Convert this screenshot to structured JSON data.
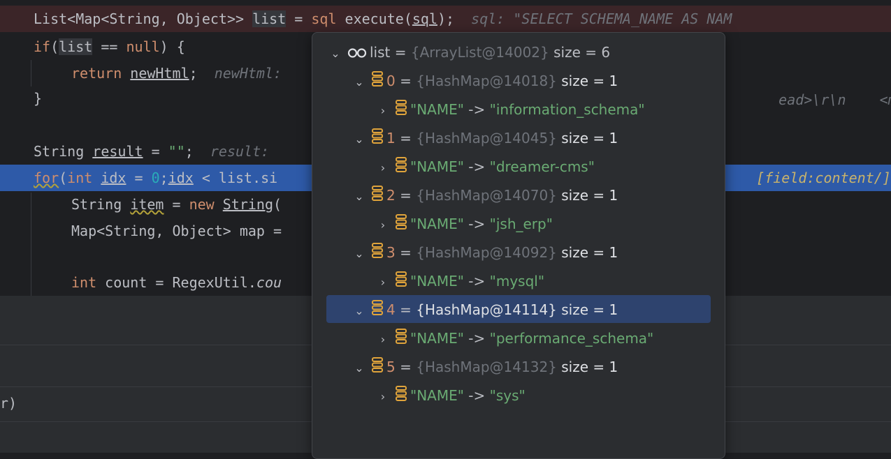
{
  "editor": {
    "lines": [
      {
        "parts": [
          [
            "",
            "List<Map<String, Object>> "
          ],
          [
            "sel",
            "list"
          ],
          [
            "",
            " = "
          ],
          [
            "kw",
            "sql"
          ],
          [
            "",
            " "
          ],
          [
            "",
            "execute("
          ],
          [
            "ul",
            "sql"
          ],
          [
            "",
            ");  "
          ],
          [
            "it",
            "sql: \"SELECT SCHEMA_NAME AS NAM"
          ]
        ]
      },
      {
        "parts": [
          [
            "kw",
            "if"
          ],
          [
            "",
            "("
          ],
          [
            "sel",
            "list"
          ],
          [
            "",
            " == "
          ],
          [
            "kw",
            "null"
          ],
          [
            "",
            ") {"
          ]
        ]
      },
      {
        "parts": [
          [
            "kw",
            "return "
          ],
          [
            "ul",
            "newHtml"
          ],
          [
            "",
            ";  "
          ],
          [
            "it",
            "newHtml:"
          ]
        ]
      },
      {
        "parts": [
          [
            "",
            "}"
          ]
        ]
      },
      {
        "parts": [
          [
            "",
            "String "
          ],
          [
            "ul",
            "result"
          ],
          [
            "",
            " = "
          ],
          [
            "str",
            "\"\""
          ],
          [
            "",
            ";  "
          ],
          [
            "it",
            "result:"
          ]
        ]
      },
      {
        "parts": [
          [
            "kw wavy",
            "for"
          ],
          [
            "",
            "("
          ],
          [
            "kw",
            "int "
          ],
          [
            "ul",
            "idx"
          ],
          [
            "",
            " = "
          ],
          [
            "num",
            "0"
          ],
          [
            "",
            ";"
          ],
          [
            "ul",
            "idx"
          ],
          [
            "",
            " < list.si"
          ]
        ]
      },
      {
        "parts": [
          [
            "",
            "String "
          ],
          [
            "ul wavy",
            "item"
          ],
          [
            "",
            " = "
          ],
          [
            "kw",
            "new "
          ],
          [
            "ul",
            "String"
          ],
          [
            "",
            "("
          ]
        ]
      },
      {
        "parts": [
          [
            "",
            "Map<String, Object> map ="
          ]
        ]
      },
      {
        "parts": [
          [
            "kw",
            "int "
          ],
          [
            "",
            "count = RegexUtil."
          ],
          [
            "ital",
            "cou"
          ]
        ]
      }
    ],
    "right_hints": {
      "line2": "ead>\\r\\n    <meta",
      "line4": "[field:content/]</"
    }
  },
  "bottom": {
    "partial_text": "r)"
  },
  "popup": {
    "root": {
      "name": "list",
      "ref": "{ArrayList@14002}",
      "size": "size = 6"
    },
    "items": [
      {
        "index": "0",
        "ref": "{HashMap@14018}",
        "size": "size = 1",
        "key": "\"NAME\"",
        "arrow": "->",
        "value": "\"information_schema\""
      },
      {
        "index": "1",
        "ref": "{HashMap@14045}",
        "size": "size = 1",
        "key": "\"NAME\"",
        "arrow": "->",
        "value": "\"dreamer-cms\""
      },
      {
        "index": "2",
        "ref": "{HashMap@14070}",
        "size": "size = 1",
        "key": "\"NAME\"",
        "arrow": "->",
        "value": "\"jsh_erp\""
      },
      {
        "index": "3",
        "ref": "{HashMap@14092}",
        "size": "size = 1",
        "key": "\"NAME\"",
        "arrow": "->",
        "value": "\"mysql\""
      },
      {
        "index": "4",
        "ref": "{HashMap@14114}",
        "size": "size = 1",
        "key": "\"NAME\"",
        "arrow": "->",
        "value": "\"performance_schema\""
      },
      {
        "index": "5",
        "ref": "{HashMap@14132}",
        "size": "size = 1",
        "key": "\"NAME\"",
        "arrow": "->",
        "value": "\"sys\""
      }
    ],
    "selected_index": 4
  },
  "colors": {
    "keyword": "#cf8e6d",
    "string": "#6aab73",
    "number": "#2aacb8",
    "current_line": "#2e5aa8",
    "breakpoint_line": "#3b2528",
    "popup_selected": "#2e436e"
  },
  "icons": {
    "watch": "infinity-glasses-icon",
    "field": "database-stack-icon",
    "expand": "chevron-right-icon",
    "collapse": "chevron-down-icon"
  }
}
